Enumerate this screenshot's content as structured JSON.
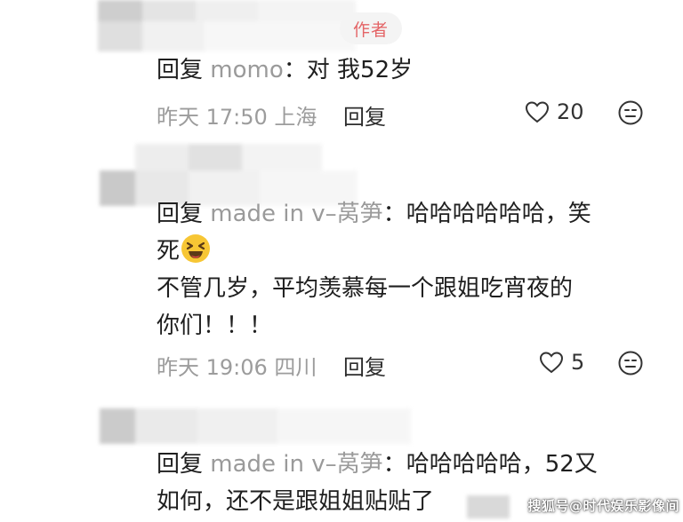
{
  "comment1": {
    "badge": "作者",
    "reply_prefix": "回复",
    "reply_target": "momo",
    "colon": "：",
    "text": "对 我52岁",
    "time": "昨天 17:50 上海",
    "reply_label": "回复",
    "likes": "20"
  },
  "comment2": {
    "reply_prefix": "回复",
    "reply_target": "made in v–莴笋",
    "colon": "：",
    "text_line1": "哈哈哈哈哈哈，笑",
    "text_line2": "死",
    "text_line3": "不管几岁，平均羡慕每一个跟姐吃宵夜的",
    "text_line4": "你们！！！",
    "time": "昨天 19:06 四川",
    "reply_label": "回复",
    "likes": "5"
  },
  "comment3": {
    "reply_prefix": "回复",
    "reply_target": "made in v–莴笋",
    "colon": "：",
    "text_line1": "哈哈哈哈哈，52又",
    "text_line2": "如何，还不是跟姐姐贴贴了"
  },
  "watermark": "搜狐号@时代娱乐影像间",
  "icons": {
    "like": "heart-outline-icon",
    "dislike": "meh-face-icon",
    "emoji": "laughing-squint-emoji"
  },
  "colors": {
    "badge_text": "#e46466",
    "muted": "#9c9c9c",
    "emoji": "#f7c634"
  }
}
